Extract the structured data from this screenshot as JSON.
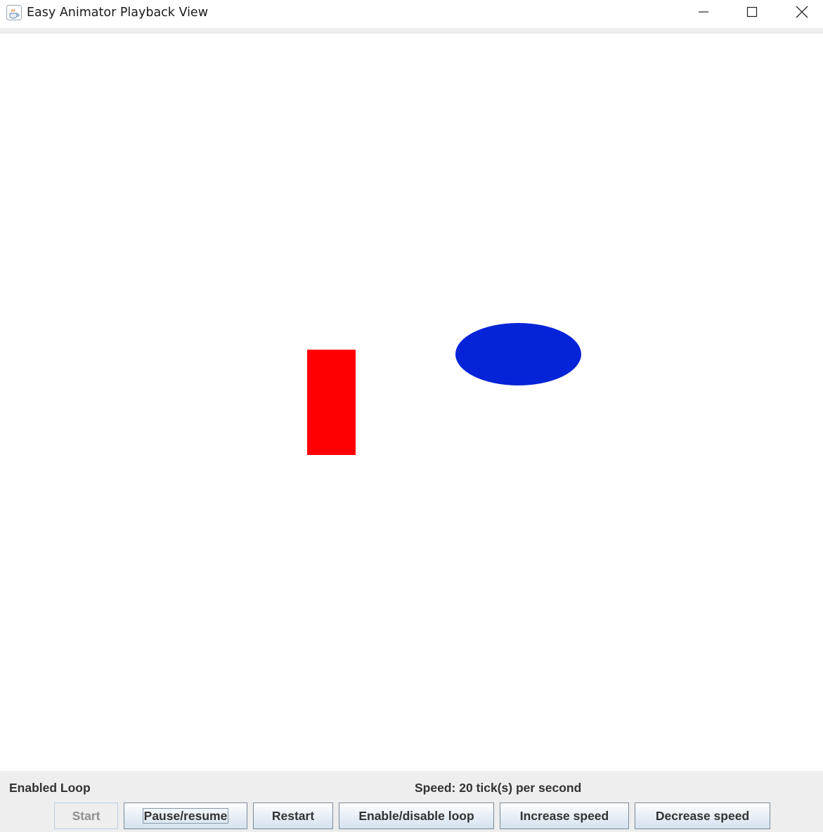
{
  "window": {
    "title": "Easy Animator Playback View",
    "controls": [
      "minimize",
      "maximize",
      "close"
    ]
  },
  "canvas": {
    "background": "#ffffff",
    "shapes": [
      {
        "type": "rectangle",
        "color": "#ff0000"
      },
      {
        "type": "ellipse",
        "color": "#0524d8"
      }
    ]
  },
  "status": {
    "loop": "Enabled Loop",
    "speed": "Speed: 20 tick(s) per second"
  },
  "buttons": {
    "start": "Start",
    "pause_resume": "Pause/resume",
    "restart": "Restart",
    "loop_toggle": "Enable/disable loop",
    "increase_speed": "Increase speed",
    "decrease_speed": "Decrease speed"
  },
  "icons": {
    "app": "java-coffee-cup-icon",
    "minimize": "minimize-icon",
    "maximize": "maximize-icon",
    "close": "close-icon"
  }
}
